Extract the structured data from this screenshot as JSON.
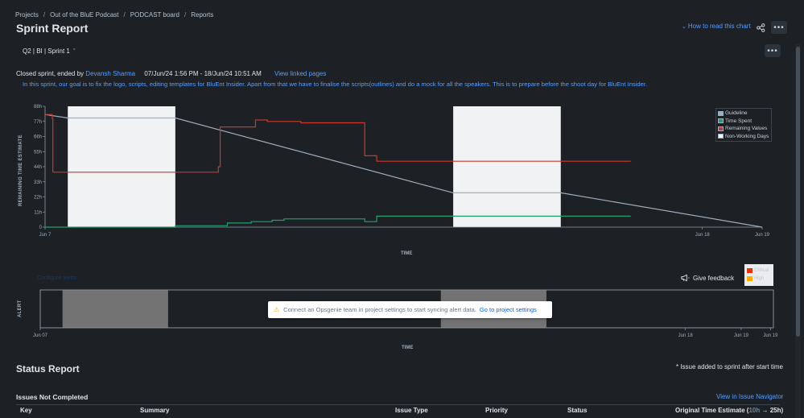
{
  "breadcrumb": [
    "Projects",
    "Out of the BluE Podcast",
    "PODCAST board",
    "Reports"
  ],
  "page_title": "Sprint Report",
  "how_to_read": "How to read this chart",
  "sprint_selector": "Q2 | BI | Sprint 1",
  "sprint_meta": {
    "prefix": "Closed sprint, ended by",
    "owner": "Devansh Sharma",
    "dates": "07/Jun/24 1:56 PM - 18/Jun/24 10:51 AM",
    "linked_pages": "View linked pages"
  },
  "sprint_goal": "In this sprint, our goal is to fix the logo, scripts, editing templates for BluEnt Insider. Apart from that we have to finalise the scripts(outlines) and do a mock for all the speakers. This is to prepare before the shoot day for BluEnt Insider.",
  "colors": {
    "guideline": "#9fadbc",
    "time_spent": "#22a06b",
    "remaining": "#c9372c",
    "non_working": "#f1f2f4",
    "critical": "#de350b",
    "high": "#ffab00",
    "link": "#579dff"
  },
  "chart_data": {
    "type": "line",
    "ylabel": "REMAINING TIME ESTIMATE",
    "xlabel": "TIME",
    "y_ticks": [
      "0",
      "11h",
      "22h",
      "33h",
      "44h",
      "55h",
      "66h",
      "77h",
      "88h"
    ],
    "x_ticks": [
      {
        "label": "Jun 7",
        "day": 0
      },
      {
        "label": "Jun 18",
        "day": 11
      },
      {
        "label": "Jun 19",
        "day": 12
      }
    ],
    "ylim": [
      0,
      88
    ],
    "xlim_days": [
      0,
      12
    ],
    "non_working_days": [
      [
        0.38,
        2.18
      ],
      [
        6.83,
        8.63
      ]
    ],
    "legend": [
      "Guideline",
      "Time Spent",
      "Remaining Values",
      "Non-Working Days"
    ],
    "legend_position": "top-right",
    "series": [
      {
        "name": "Guideline",
        "points": [
          [
            0,
            82
          ],
          [
            0.38,
            79.5
          ],
          [
            2.18,
            79.5
          ],
          [
            6.83,
            25
          ],
          [
            8.63,
            25
          ],
          [
            12,
            0
          ]
        ]
      },
      {
        "name": "Remaining Values",
        "points": [
          [
            0,
            82
          ],
          [
            0.12,
            82
          ],
          [
            0.12,
            79
          ],
          [
            0.13,
            79
          ],
          [
            0.13,
            40
          ],
          [
            2.9,
            40
          ],
          [
            2.9,
            44
          ],
          [
            2.93,
            44
          ],
          [
            2.93,
            73
          ],
          [
            3.52,
            73
          ],
          [
            3.52,
            78
          ],
          [
            3.72,
            78
          ],
          [
            3.72,
            77
          ],
          [
            4.28,
            77
          ],
          [
            4.28,
            76
          ],
          [
            5.35,
            76
          ],
          [
            5.35,
            52
          ],
          [
            5.55,
            52
          ],
          [
            5.55,
            48
          ],
          [
            9.8,
            48
          ]
        ]
      },
      {
        "name": "Time Spent",
        "points": [
          [
            0,
            0
          ],
          [
            2.18,
            0
          ],
          [
            2.18,
            1
          ],
          [
            3.05,
            1
          ],
          [
            3.05,
            3
          ],
          [
            3.45,
            3
          ],
          [
            3.45,
            4
          ],
          [
            3.8,
            4
          ],
          [
            3.8,
            5
          ],
          [
            4.0,
            5
          ],
          [
            4.0,
            6
          ],
          [
            5.35,
            6
          ],
          [
            5.35,
            4
          ],
          [
            5.55,
            4
          ],
          [
            5.55,
            8
          ],
          [
            9.8,
            8
          ]
        ]
      }
    ]
  },
  "alerts": {
    "ylabel": "ALERT",
    "xlabel": "TIME",
    "link_hint": "Configure alerts",
    "feedback": "Give feedback",
    "legend": [
      "Critical",
      "High"
    ],
    "banner_text": "Connect an Opsgenie team in project settings to start syncing alert data.",
    "banner_link": "Go to project settings",
    "x_ticks": [
      {
        "label": "Jun 07",
        "day": 0
      },
      {
        "label": "Jun 18",
        "day": 11
      },
      {
        "label": "Jun 19",
        "day": 11.95
      },
      {
        "label": "Jun 19",
        "day": 12.45
      }
    ],
    "non_working_days": [
      [
        0.38,
        2.18
      ],
      [
        6.83,
        8.63
      ]
    ]
  },
  "status_report": {
    "title": "Status Report",
    "note": "* Issue added to sprint after start time",
    "issues_not_completed": "Issues Not Completed",
    "view_in_navigator": "View in Issue Navigator",
    "columns": [
      "Key",
      "Summary",
      "Issue Type",
      "Priority",
      "Status"
    ],
    "estimate_header": {
      "label": "Original Time Estimate (",
      "from": "10h",
      "arrow": "→",
      "to": "25h",
      "close": ")"
    }
  }
}
